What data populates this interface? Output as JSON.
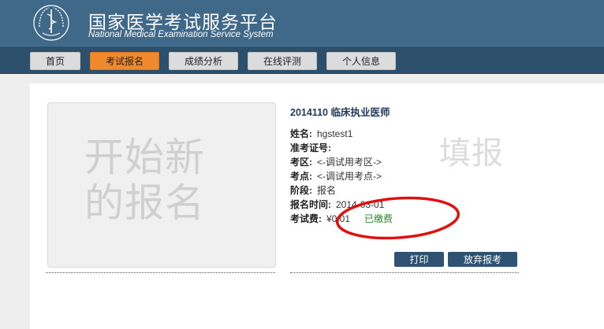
{
  "header": {
    "title_cn": "国家医学考试服务平台",
    "title_en": "National Medical Examination Service System",
    "logo_icon": "medical-caduceus-emblem"
  },
  "nav": {
    "items": [
      {
        "label": "首页",
        "active": false
      },
      {
        "label": "考试报名",
        "active": true
      },
      {
        "label": "成绩分析",
        "active": false
      },
      {
        "label": "在线评测",
        "active": false
      },
      {
        "label": "个人信息",
        "active": false
      }
    ]
  },
  "new_registration": {
    "label_line1": "开始新",
    "label_line2": "的报名"
  },
  "registration": {
    "exam_title": "2014110 临床执业医师",
    "name_label": "姓名:",
    "name_value": "hgstest1",
    "ticket_label": "准考证号:",
    "ticket_value": "",
    "area_label": "考区:",
    "area_value": "<-调试用考区->",
    "site_label": "考点:",
    "site_value": "<-调试用考点->",
    "stage_label": "阶段:",
    "stage_value": "报名",
    "time_label": "报名时间:",
    "time_value": "2014-03-01",
    "fee_label": "考试费:",
    "fee_value": "¥0.01",
    "fee_status": "已缴费",
    "stamp_text": "填报",
    "print_button": "打印",
    "abandon_button": "放弃报考"
  },
  "colors": {
    "header_bg": "#3f6889",
    "nav_bg": "#2c4f6c",
    "active_tab": "#ef8a2c",
    "action_button": "#2f5272",
    "paid_status": "#2a8a2a",
    "annotation": "#e01010"
  }
}
